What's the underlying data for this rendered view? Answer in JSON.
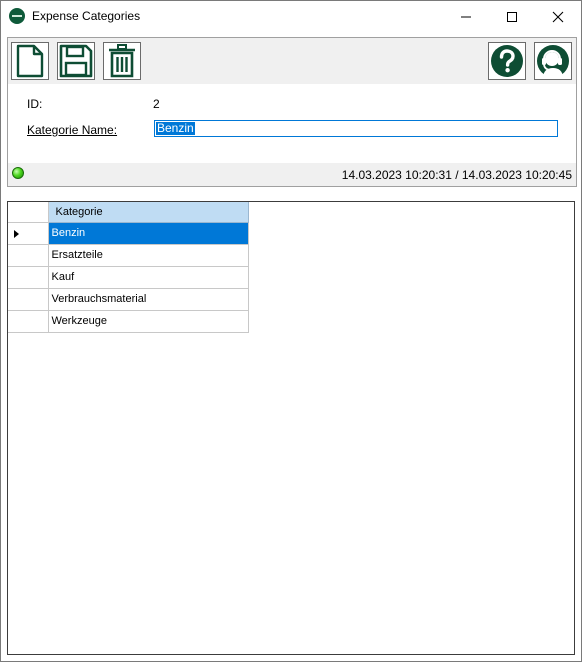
{
  "window": {
    "title": "Expense Categories",
    "icons": {
      "app": "app-logo-icon",
      "minimize": "minimize-icon",
      "maximize": "maximize-icon",
      "close": "close-icon"
    }
  },
  "toolbar": {
    "buttons": [
      {
        "name": "new-button",
        "icon": "new-document-icon"
      },
      {
        "name": "save-button",
        "icon": "floppy-disk-icon"
      },
      {
        "name": "delete-button",
        "icon": "trash-icon"
      },
      {
        "name": "help-button",
        "icon": "question-icon"
      },
      {
        "name": "support-button",
        "icon": "support-headset-icon"
      }
    ],
    "icon_color": "#0e4d34"
  },
  "form": {
    "id_label": "ID:",
    "id_value": "2",
    "name_label": "Kategorie Name:",
    "name_value": "Benzin"
  },
  "status": {
    "indicator_color": "#4cd61e",
    "timestamps": "14.03.2023 10:20:31 / 14.03.2023 10:20:45"
  },
  "grid": {
    "column_header": "Kategorie",
    "rows": [
      "Benzin",
      "Ersatzteile",
      "Kauf",
      "Verbrauchsmaterial",
      "Werkzeuge"
    ],
    "selected_index": 0,
    "selection_color": "#0078d7",
    "header_color": "#bfdcf3"
  }
}
